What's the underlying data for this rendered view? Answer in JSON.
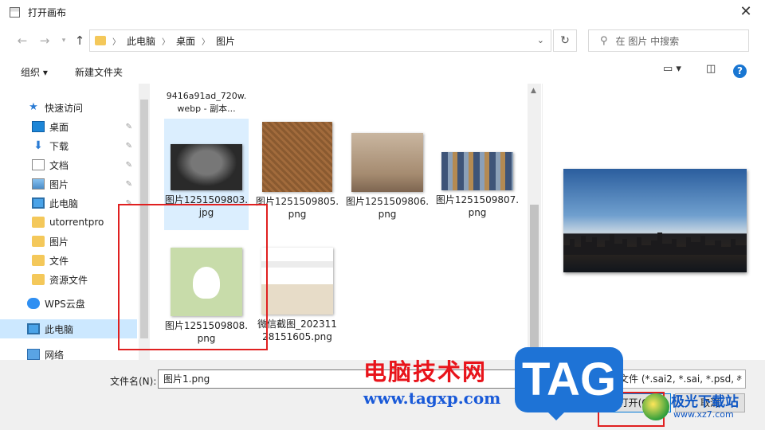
{
  "window": {
    "title": "打开画布"
  },
  "address": {
    "crumbs": [
      "此电脑",
      "桌面",
      "图片"
    ],
    "search_placeholder": "在 图片 中搜索"
  },
  "toolbar": {
    "organize": "组织 ▾",
    "new_folder": "新建文件夹"
  },
  "sidebar": {
    "items": [
      {
        "label": "快速访问",
        "icon": "star-icon"
      },
      {
        "label": "桌面",
        "icon": "desktop-icon",
        "pinned": true
      },
      {
        "label": "下载",
        "icon": "download-icon",
        "pinned": true
      },
      {
        "label": "文档",
        "icon": "document-icon",
        "pinned": true
      },
      {
        "label": "图片",
        "icon": "pictures-icon",
        "pinned": true
      },
      {
        "label": "此电脑",
        "icon": "computer-icon",
        "pinned": true
      },
      {
        "label": "utorrentpro",
        "icon": "folder-icon"
      },
      {
        "label": "图片",
        "icon": "folder-icon"
      },
      {
        "label": "文件",
        "icon": "folder-icon"
      },
      {
        "label": "资源文件",
        "icon": "folder-icon"
      },
      {
        "label": "WPS云盘",
        "icon": "cloud-icon"
      },
      {
        "label": "此电脑",
        "icon": "computer-icon",
        "selected": true
      },
      {
        "label": "网络",
        "icon": "network-icon"
      }
    ]
  },
  "files": {
    "partial_top": "9416a91ad_720w.webp - 副本...",
    "items": [
      {
        "name": "图片1251509803.jpg",
        "selected": true
      },
      {
        "name": "图片1251509805.png"
      },
      {
        "name": "图片1251509806.png"
      },
      {
        "name": "图片1251509807.png"
      },
      {
        "name": "图片1251509808.png"
      },
      {
        "name": "微信截图_20231128151605.png"
      }
    ]
  },
  "bottom": {
    "filename_label": "文件名(N):",
    "filename_value": "图片1.png",
    "filetype_value": "画布文件 (*.sai2, *.sai, *.psd, *",
    "open_button": "打开(O)",
    "cancel_button": "取消"
  },
  "watermark": {
    "cn": "电脑技术网",
    "url": "www.tagxp.com",
    "tag": "TAG",
    "site_cn": "极光下载站",
    "site_url": "www.xz7.com"
  },
  "colors": {
    "accent": "#0078d7",
    "selection": "#cce8ff",
    "highlight_box": "#e02020"
  }
}
